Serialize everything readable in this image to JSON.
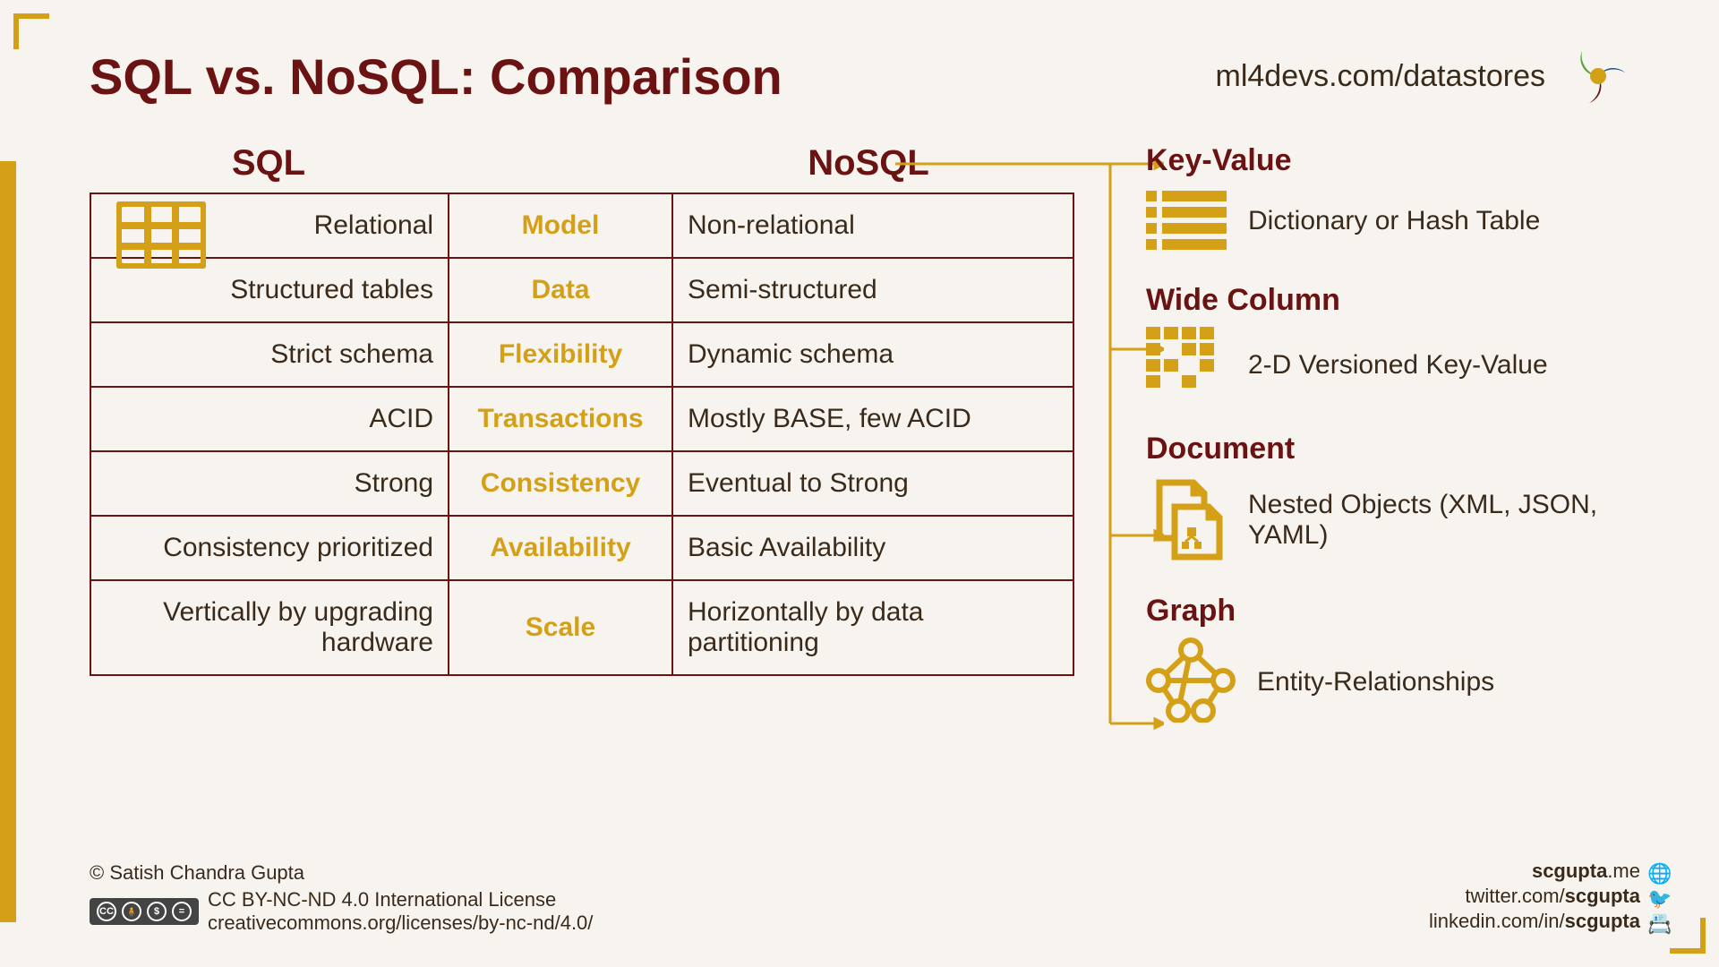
{
  "title": "SQL vs. NoSQL: Comparison",
  "header_link": "ml4devs.com/datastores",
  "columns": {
    "sql": "SQL",
    "nosql": "NoSQL"
  },
  "rows": [
    {
      "sql": "Relational",
      "key": "Model",
      "nosql": "Non-relational"
    },
    {
      "sql": "Structured tables",
      "key": "Data",
      "nosql": "Semi-structured"
    },
    {
      "sql": "Strict schema",
      "key": "Flexibility",
      "nosql": "Dynamic schema"
    },
    {
      "sql": "ACID",
      "key": "Transactions",
      "nosql": "Mostly BASE, few ACID"
    },
    {
      "sql": "Strong",
      "key": "Consistency",
      "nosql": "Eventual to Strong"
    },
    {
      "sql": "Consistency prioritized",
      "key": "Availability",
      "nosql": "Basic Availability"
    },
    {
      "sql": "Vertically by upgrading hardware",
      "key": "Scale",
      "nosql": "Horizontally by data partitioning"
    }
  ],
  "types": [
    {
      "title": "Key-Value",
      "desc": "Dictionary or Hash Table"
    },
    {
      "title": "Wide Column",
      "desc": "2-D Versioned Key-Value"
    },
    {
      "title": "Document",
      "desc": "Nested Objects (XML, JSON, YAML)"
    },
    {
      "title": "Graph",
      "desc": "Entity-Relationships"
    }
  ],
  "footer": {
    "copyright": "© Satish Chandra Gupta",
    "license_name": "CC BY-NC-ND 4.0 International License",
    "license_url": "creativecommons.org/licenses/by-nc-nd/4.0/",
    "links": {
      "site_prefix": "scgupta",
      "site_suffix": ".me",
      "twitter_prefix": "twitter.com/",
      "twitter_handle": "scgupta",
      "linkedin_prefix": "linkedin.com/in/",
      "linkedin_handle": "scgupta"
    },
    "cc_badges": [
      "CC",
      "BY",
      "NC",
      "ND"
    ]
  }
}
